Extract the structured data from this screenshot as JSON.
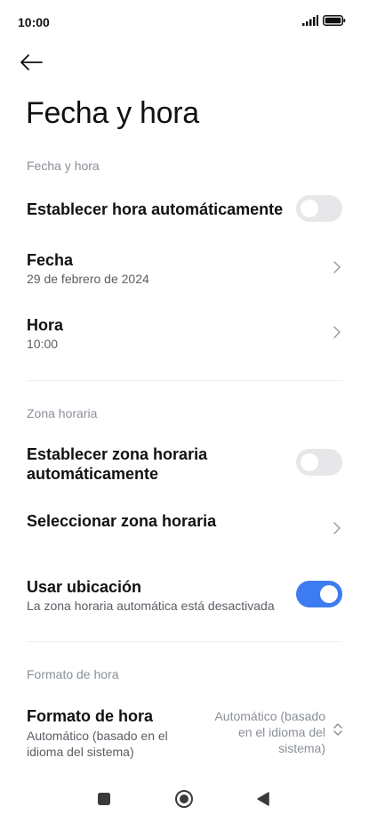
{
  "status_bar": {
    "time": "10:00",
    "icons": [
      "signal-icon",
      "battery-icon"
    ]
  },
  "header": {
    "back_icon": "arrow-left-icon",
    "title": "Fecha y hora"
  },
  "sections": {
    "date_time": {
      "label": "Fecha y hora",
      "auto_time": {
        "title": "Establecer hora automáticamente",
        "enabled": false
      },
      "date": {
        "title": "Fecha",
        "value": "29 de febrero de 2024"
      },
      "time": {
        "title": "Hora",
        "value": "10:00"
      }
    },
    "timezone": {
      "label": "Zona horaria",
      "auto_timezone": {
        "title_line1": "Establecer zona horaria",
        "title_line2": "automáticamente",
        "enabled": false
      },
      "select_timezone": {
        "title": "Seleccionar zona horaria"
      },
      "use_location": {
        "title": "Usar ubicación",
        "subtitle": "La zona horaria automática está desactivada",
        "enabled": true
      }
    },
    "time_format": {
      "label": "Formato de hora",
      "format": {
        "title": "Formato de hora",
        "subtitle_line1": "Automático (basado en el",
        "subtitle_line2": "idioma del sistema)",
        "value_line1": "Automático (basado",
        "value_line2": "en el idioma del",
        "value_line3": "sistema)"
      }
    }
  },
  "colors": {
    "accent": "#3d7bf0",
    "toggle_off": "#e7e7ea",
    "secondary_text": "#8a8f99"
  },
  "nav_bar": {
    "icons": [
      "recents-square-icon",
      "home-circle-icon",
      "back-triangle-icon"
    ]
  }
}
